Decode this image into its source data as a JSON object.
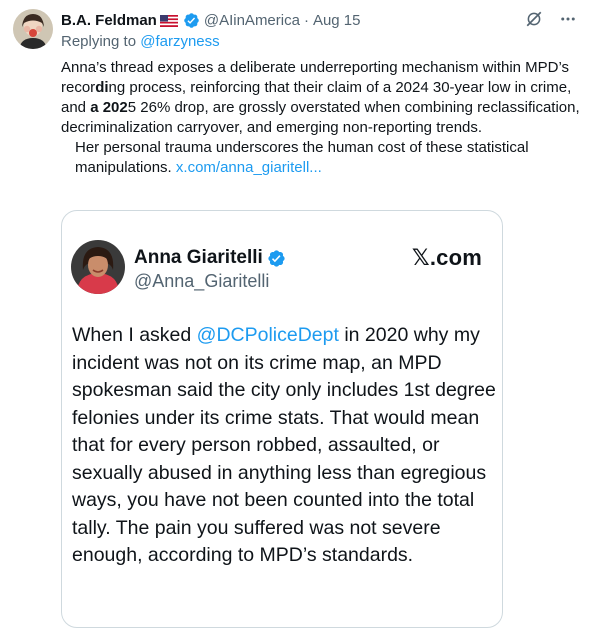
{
  "post": {
    "author_name": "B.A. Feldman",
    "author_flag": "US flag",
    "author_handle": "@AIinAmerica",
    "separator": "·",
    "date": "Aug 15",
    "replying_prefix": "Replying to ",
    "replying_handle": "@farzyness",
    "text": {
      "p1_a": "Anna’s thread exposes a deliberate underreporting mechanism within MPD’s recor",
      "p1_b": "di",
      "p1_c": "ng process, reinforcing that their claim of a 2024 30-year low in crime, and ",
      "p1_d": "a 202",
      "p1_e": "5 26% drop, are grossly overstated when combining reclassification, decriminalization carryover, and emerging non-reporting trends.",
      "p2": "Her personal trauma underscores the human cost of these statistical manipulations. ",
      "p2_link": "x.com/anna_giaritell..."
    }
  },
  "quote": {
    "name": "Anna Giaritelli",
    "handle": "@Anna_Giaritelli",
    "source": ".com",
    "source_mark": "𝕏",
    "body_a": "When I asked ",
    "body_mention": "@DCPoliceDept",
    "body_b": " in 2020 why my incident was not on its crime map, an MPD spokesman said the city only includes 1st degree felonies under its crime stats. That would mean that for every person robbed, assaulted, or sexually abused in anything less than egregious ways, you have not been counted into the total tally. The pain you suffered was not severe enough, according to MPD’s standards."
  },
  "icons": {
    "verified": "verified-badge-icon",
    "grok": "grok-icon",
    "more": "more-icon"
  },
  "colors": {
    "accent": "#1d9bf0",
    "text": "#0f1419",
    "muted": "#536471",
    "border": "#cfd9de"
  }
}
